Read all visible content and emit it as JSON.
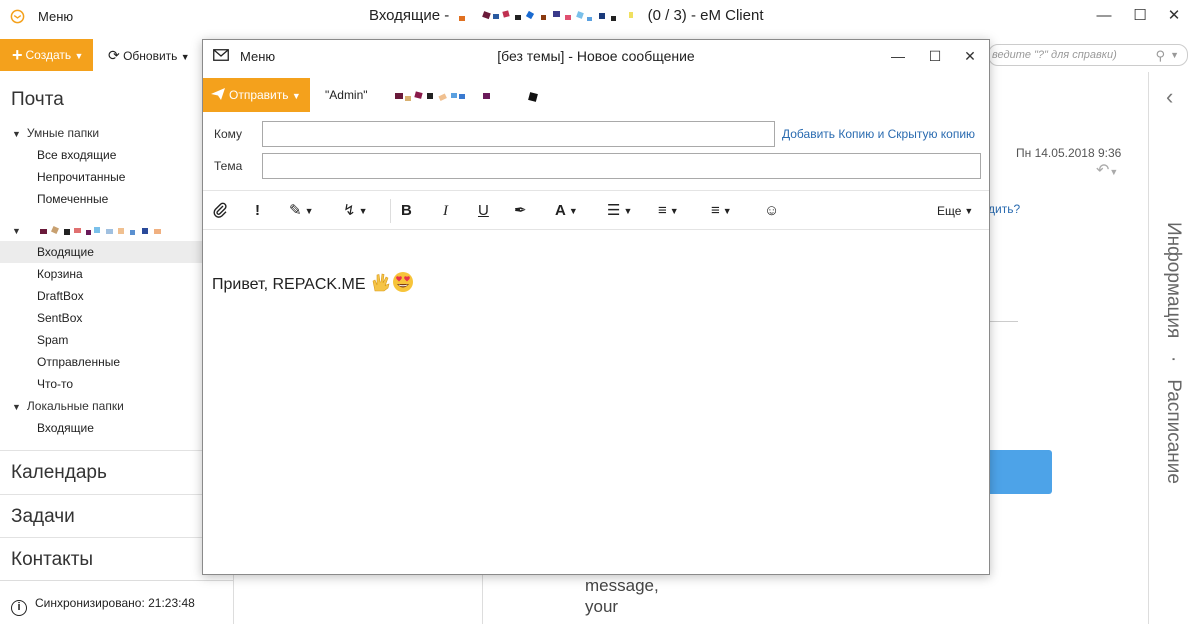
{
  "app": {
    "menu_label": "Меню",
    "title_prefix": "Входящие -",
    "title_suffix": "(0 / 3) - eM Client"
  },
  "toolbar": {
    "create_label": "Создать",
    "refresh_label": "Обновить",
    "search_placeholder": "ведите \"?\" для справки)"
  },
  "sidebar": {
    "mail_title": "Почта",
    "smart_folders_label": "Умные папки",
    "smart_folders": [
      {
        "label": "Все входящие"
      },
      {
        "label": "Непрочитанные"
      },
      {
        "label": "Помеченные"
      }
    ],
    "account_folders": [
      {
        "label": "Входящие",
        "selected": true
      },
      {
        "label": "Корзина"
      },
      {
        "label": "DraftBox"
      },
      {
        "label": "SentBox"
      },
      {
        "label": "Spam"
      },
      {
        "label": "Отправленные"
      },
      {
        "label": "Что-то"
      }
    ],
    "local_folders_label": "Локальные папки",
    "local_folders": [
      {
        "label": "Входящие"
      }
    ],
    "calendar_label": "Календарь",
    "tasks_label": "Задачи",
    "contacts_label": "Контакты",
    "status_text": "Синхронизировано: 21:23:48"
  },
  "right_panel": {
    "info_label": "Информация",
    "separator": "·",
    "schedule_label": "Расписание"
  },
  "background": {
    "date_text": "Пн 14.05.2018 9:36",
    "link_text": "дить?",
    "message_line1": "message,",
    "message_line2": "your"
  },
  "compose": {
    "menu_label": "Меню",
    "title": "[без темы] - Новое сообщение",
    "send_label": "Отправить",
    "from_label": "\"Admin\"",
    "to_label": "Кому",
    "to_value": "",
    "cc_link": "Добавить Копию и Скрытую копию",
    "subject_label": "Тема",
    "subject_value": "",
    "more_label": "Еще",
    "body_text": "Привет, REPACK.ME"
  },
  "colors": {
    "accent": "#f4a11c",
    "link": "#2a6bb0",
    "selected_bg": "#ececec"
  }
}
